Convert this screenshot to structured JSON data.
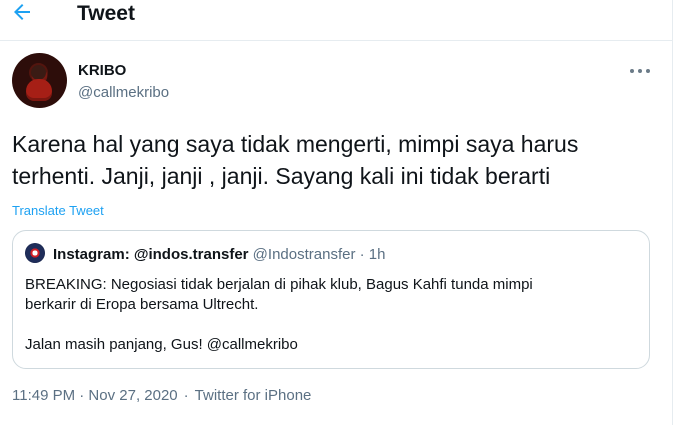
{
  "header": {
    "title": "Tweet",
    "back_icon": "arrow-left-icon",
    "accent_color": "#1da1f2"
  },
  "tweet": {
    "author": {
      "display_name": "KRIBO",
      "username": "@callmekribo"
    },
    "text": "Karena hal yang saya tidak mengerti, mimpi saya harus\nterhenti. Janji, janji , janji. Sayang kali ini tidak berarti",
    "translate_label": "Translate Tweet",
    "more_icon": "more-horizontal-icon",
    "timestamp": "11:49 PM · Nov 27, 2020",
    "client": "Twitter for iPhone"
  },
  "quoted_tweet": {
    "display_name": "Instagram: @indos.transfer",
    "username": "@Indostransfer",
    "time": "1h",
    "text": "BREAKING: Negosiasi tidak berjalan di pihak klub, Bagus Kahfi tunda mimpi\nberkarir di Eropa bersama Ultrecht.\n\nJalan masih panjang, Gus! @callmekribo"
  }
}
